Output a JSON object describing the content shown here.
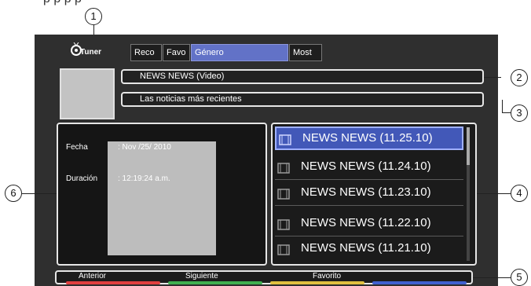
{
  "header": {
    "partial_text": "p p p p",
    "logo_text": "Tuner",
    "tabs": [
      {
        "label": "Reco",
        "active": false
      },
      {
        "label": "Favo",
        "active": false
      },
      {
        "label": "Género",
        "active": true
      },
      {
        "label": "Most",
        "active": false
      }
    ]
  },
  "callouts": [
    "1",
    "2",
    "3",
    "4",
    "5",
    "6"
  ],
  "info": {
    "title": "NEWS NEWS (Video)",
    "description": "Las noticias más recientes"
  },
  "detail": {
    "fecha_label": "Fecha",
    "fecha_value": ": Nov /25/ 2010",
    "duracion_label": "Duración",
    "duracion_value": ": 12:19:24 a.m."
  },
  "list": {
    "items": [
      {
        "label": "NEWS NEWS (11.25.10)",
        "selected": true
      },
      {
        "label": "NEWS NEWS (11.24.10)",
        "selected": false
      },
      {
        "label": "NEWS NEWS (11.23.10)",
        "selected": false
      },
      {
        "label": "NEWS NEWS (11.22.10)",
        "selected": false
      },
      {
        "label": "NEWS NEWS (11.21.10)",
        "selected": false
      }
    ]
  },
  "bottom": {
    "buttons": [
      {
        "label": "Anterior",
        "color": "#e04040"
      },
      {
        "label": "Siguiente",
        "color": "#40b050"
      },
      {
        "label": "Favorito",
        "color": "#e0c040"
      },
      {
        "label": "",
        "color": "#4060d0"
      }
    ]
  },
  "colors": {
    "tab_active": "#6272c7",
    "row_selected": "#4258b8",
    "frame": "#2f2f2f"
  }
}
